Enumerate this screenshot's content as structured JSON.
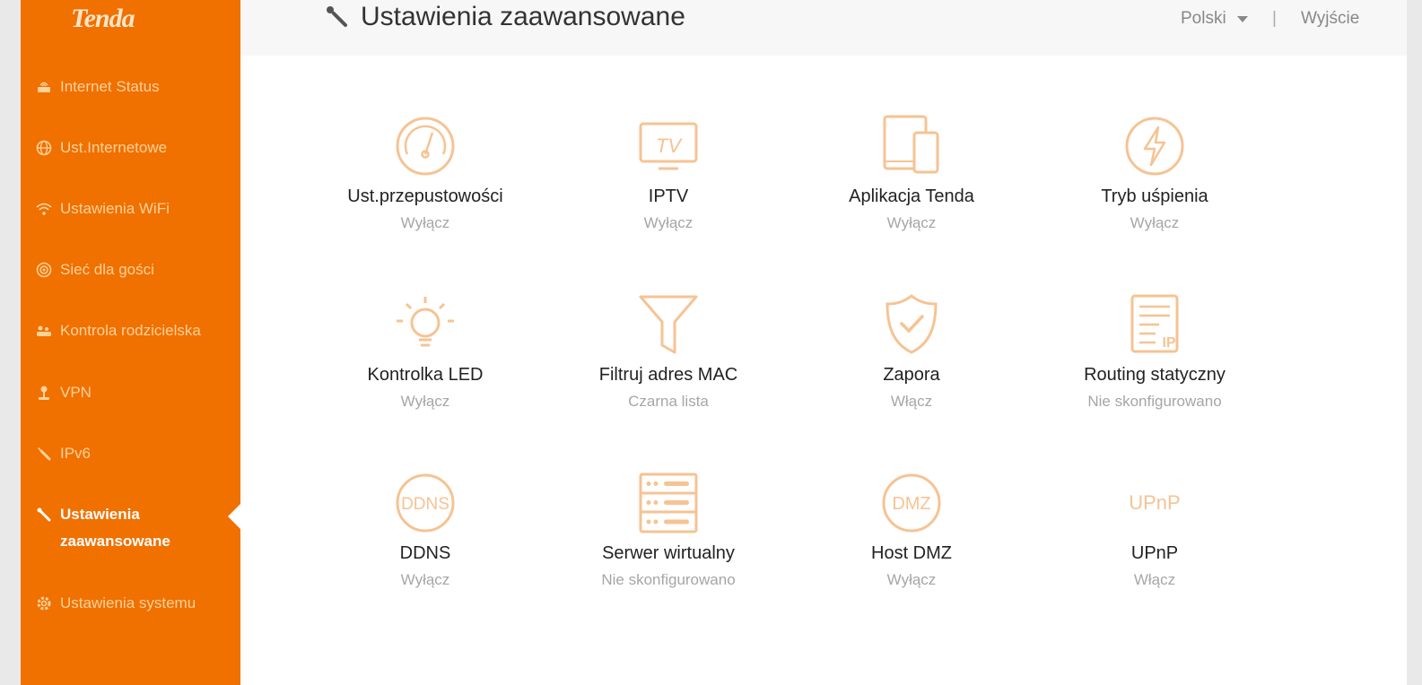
{
  "brand": {
    "logo": "Tenda",
    "accent": "#f07000",
    "icon_color": "#f6c393"
  },
  "sidebar": {
    "items": [
      {
        "label": "Internet Status",
        "icon": "router-icon"
      },
      {
        "label": "Ust.Internetowe",
        "icon": "globe-icon"
      },
      {
        "label": "Ustawienia WiFi",
        "icon": "wifi-icon"
      },
      {
        "label": "Sieć dla gości",
        "icon": "guest-network-icon"
      },
      {
        "label": "Kontrola rodzicielska",
        "icon": "parental-icon"
      },
      {
        "label": "VPN",
        "icon": "vpn-icon"
      },
      {
        "label": "IPv6",
        "icon": "wrench-icon"
      },
      {
        "label": "Ustawienia zaawansowane",
        "icon": "tools-icon",
        "active": true
      },
      {
        "label": "Ustawienia systemu",
        "icon": "gear-icon"
      }
    ]
  },
  "header": {
    "title": "Ustawienia zaawansowane",
    "language": "Polski",
    "separator": "|",
    "logout": "Wyjście"
  },
  "tiles": [
    {
      "name": "Ust.przepustowości",
      "state": "Wyłącz",
      "icon": "speedometer-icon"
    },
    {
      "name": "IPTV",
      "state": "Wyłącz",
      "icon": "tv-icon"
    },
    {
      "name": "Aplikacja Tenda",
      "state": "Wyłącz",
      "icon": "devices-icon"
    },
    {
      "name": "Tryb uśpienia",
      "state": "Wyłącz",
      "icon": "lightning-icon"
    },
    {
      "name": "Kontrolka LED",
      "state": "Wyłącz",
      "icon": "bulb-icon"
    },
    {
      "name": "Filtruj adres MAC",
      "state": "Czarna lista",
      "icon": "filter-icon"
    },
    {
      "name": "Zapora",
      "state": "Włącz",
      "icon": "shield-icon"
    },
    {
      "name": "Routing statyczny",
      "state": "Nie skonfigurowano",
      "icon": "routing-list-icon",
      "icon_text": "IP"
    },
    {
      "name": "DDNS",
      "state": "Wyłącz",
      "icon": "ddns-icon",
      "icon_text": "DDNS"
    },
    {
      "name": "Serwer wirtualny",
      "state": "Nie skonfigurowano",
      "icon": "server-icon"
    },
    {
      "name": "Host DMZ",
      "state": "Wyłącz",
      "icon": "dmz-icon",
      "icon_text": "DMZ"
    },
    {
      "name": "UPnP",
      "state": "Włącz",
      "icon": "upnp-icon",
      "icon_text": "UPnP"
    }
  ]
}
